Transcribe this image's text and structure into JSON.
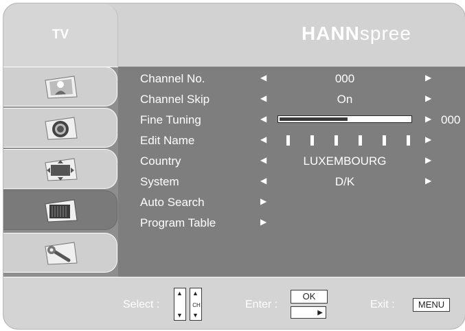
{
  "header": {
    "tab_label": "TV",
    "brand_bold": "HANN",
    "brand_light": "spree"
  },
  "sidebar": {
    "icons": [
      "picture-icon",
      "audio-icon",
      "display-icon",
      "tv-icon",
      "setup-icon"
    ],
    "active_index": 3
  },
  "menu": {
    "rows": [
      {
        "label": "Channel No.",
        "value": "000",
        "arrows": "both"
      },
      {
        "label": "Channel Skip",
        "value": "On",
        "arrows": "both"
      },
      {
        "label": "Fine Tuning",
        "value": "000",
        "arrows": "both",
        "slider_fraction": 0.52
      },
      {
        "label": "Edit Name",
        "value": "",
        "arrows": "both",
        "name_slots": 6
      },
      {
        "label": "Country",
        "value": "LUXEMBOURG",
        "arrows": "both"
      },
      {
        "label": "System",
        "value": "D/K",
        "arrows": "both"
      },
      {
        "label": "Auto Search",
        "arrows": "enter"
      },
      {
        "label": "Program Table",
        "arrows": "enter"
      }
    ]
  },
  "footer": {
    "select_label": "Select :",
    "ch_label": "CH",
    "enter_label": "Enter :",
    "ok_label": "OK",
    "exit_label": "Exit :",
    "menu_label": "MENU"
  },
  "colors": {
    "panel": "#8e8e8e",
    "header": "#d2d2d2",
    "menu_bg": "#7e7e7e",
    "text": "#ffffff"
  }
}
